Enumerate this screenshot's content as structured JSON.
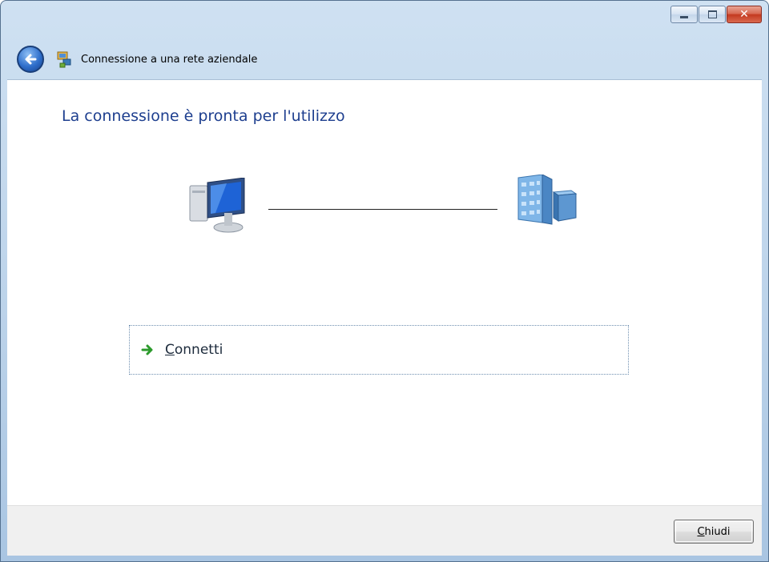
{
  "window": {
    "title": "Connessione a una rete aziendale",
    "caption_buttons": [
      "minimize-icon",
      "maximize-icon",
      "close-icon"
    ]
  },
  "content": {
    "heading": "La connessione è pronta per l'utilizzo",
    "connection_visual": {
      "left_icon": "computer-icon",
      "right_icon": "corporate-network-building-icon"
    },
    "command_link": {
      "icon": "green-arrow-icon",
      "accel": "C",
      "rest": "onnetti"
    }
  },
  "footer": {
    "close_button": {
      "accel": "C",
      "rest": "hiudi"
    }
  },
  "colors": {
    "heading": "#1e3f8f",
    "titlebar": "#bcd3ea",
    "footer": "#f0f0f0",
    "arrow": "#2c9a2c"
  }
}
